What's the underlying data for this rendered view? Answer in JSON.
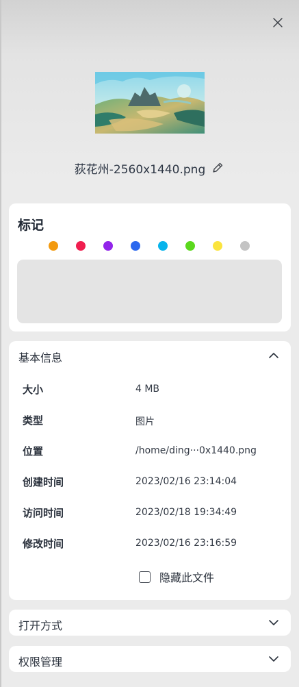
{
  "panel": {
    "close_icon": "close-icon",
    "filename": "荻花州-2560x1440.png",
    "edit_icon": "pencil-icon"
  },
  "tags": {
    "title": "标记",
    "colors": [
      "#f39a0f",
      "#f01e4f",
      "#9224ea",
      "#2b68ee",
      "#08b4ec",
      "#5bd81d",
      "#fbe43e",
      "#c4c4c4"
    ]
  },
  "basic_info": {
    "title": "基本信息",
    "expanded": true,
    "rows": [
      {
        "label": "大小",
        "value": "4 MB"
      },
      {
        "label": "类型",
        "value": "图片"
      },
      {
        "label": "位置",
        "value": "/home/ding···0x1440.png"
      },
      {
        "label": "创建时间",
        "value": "2023/02/16 23:14:04"
      },
      {
        "label": "访问时间",
        "value": "2023/02/18 19:34:49"
      },
      {
        "label": "修改时间",
        "value": "2023/02/16 23:16:59"
      }
    ],
    "hide_file_label": "隐藏此文件",
    "hide_file_checked": false
  },
  "open_with": {
    "title": "打开方式",
    "expanded": false
  },
  "permissions": {
    "title": "权限管理",
    "expanded": false
  }
}
